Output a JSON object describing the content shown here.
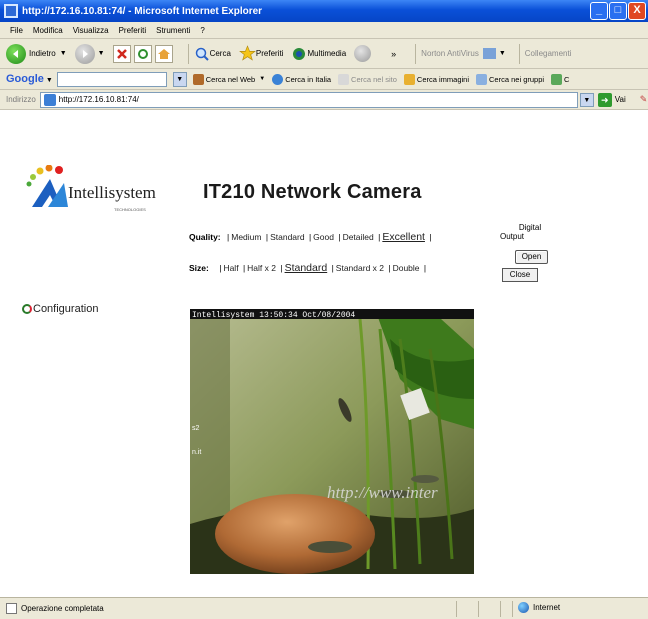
{
  "window": {
    "title": "http://172.16.10.81:74/ - Microsoft Internet Explorer",
    "controls": [
      "_",
      "□",
      "X"
    ]
  },
  "menu": [
    "File",
    "Modifica",
    "Visualizza",
    "Preferiti",
    "Strumenti",
    "?"
  ],
  "toolbar": {
    "back": "Indietro",
    "search": "Cerca",
    "favorites": "Preferiti",
    "media": "Multimedia",
    "chevron": "»",
    "norton": "Norton AntiVirus",
    "links": "Collegamenti"
  },
  "googlebar": {
    "brand": "Google",
    "search_web": "Cerca nel Web",
    "search_italy": "Cerca in Italia",
    "search_site": "Cerca nel sito",
    "search_images": "Cerca immagini",
    "search_groups": "Cerca nei gruppi",
    "more": "C"
  },
  "addressbar": {
    "label": "Indirizzo",
    "url": "http://172.16.10.81:74/",
    "go": "Vai"
  },
  "page": {
    "logo_text": "Intellisystem",
    "logo_sub": "TECHNOLOGIES",
    "title": "IT210 Network Camera",
    "quality": {
      "label": "Quality:",
      "options": [
        "Medium",
        "Standard",
        "Good",
        "Detailed",
        "Excellent"
      ],
      "selected": "Excellent"
    },
    "size": {
      "label": "Size:",
      "options": [
        "Half",
        "Half x 2",
        "Standard",
        "Standard x 2",
        "Double"
      ],
      "selected": "Standard"
    },
    "digital_output": {
      "title": "Digital",
      "subtitle": "Output",
      "open": "Open",
      "close": "Close"
    },
    "configuration": "Configuration",
    "camera": {
      "overlay": "Intellisystem 13:50:34 Oct/08/2004",
      "watermark": "http://www.inter",
      "side_text_1": "s2",
      "side_text_2": "n.it"
    }
  },
  "status": {
    "text": "Operazione completata",
    "zone": "Internet"
  },
  "colors": {
    "titlebar": "#0a50d8",
    "chrome": "#ece9d8",
    "close_button": "#e04822"
  }
}
